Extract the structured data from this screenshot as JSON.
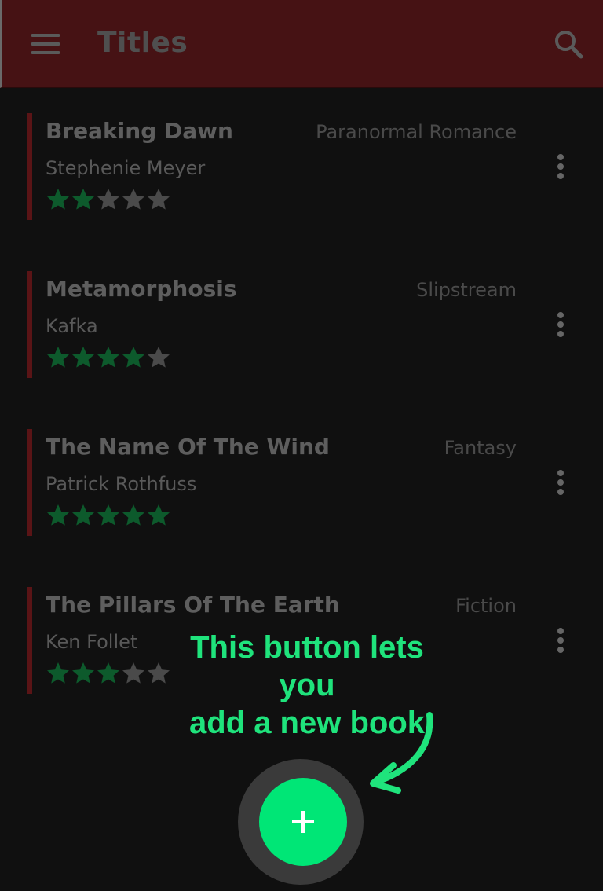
{
  "appbar": {
    "title": "Titles",
    "menu_icon": "hamburger-menu-icon",
    "search_icon": "search-icon"
  },
  "colors": {
    "appbar_bg": "#461214",
    "accent_bar": "#5a1416",
    "star_filled": "#0d5a2c",
    "star_empty": "#4a4a4a",
    "fab": "#00e676",
    "annotation": "#1fe37c"
  },
  "books": [
    {
      "title": "Breaking Dawn",
      "genre": "Paranormal Romance",
      "author": "Stephenie Meyer",
      "rating": 2,
      "max_rating": 5
    },
    {
      "title": "Metamorphosis",
      "genre": "Slipstream",
      "author": "Kafka",
      "rating": 4,
      "max_rating": 5
    },
    {
      "title": "The Name Of The Wind",
      "genre": "Fantasy",
      "author": "Patrick Rothfuss",
      "rating": 5,
      "max_rating": 5
    },
    {
      "title": "The Pillars Of The Earth",
      "genre": "Fiction",
      "author": "Ken Follet",
      "rating": 3,
      "max_rating": 5
    }
  ],
  "annotation": {
    "line1": "This button lets you",
    "line2": "add a new book"
  },
  "fab": {
    "icon": "plus-icon"
  }
}
